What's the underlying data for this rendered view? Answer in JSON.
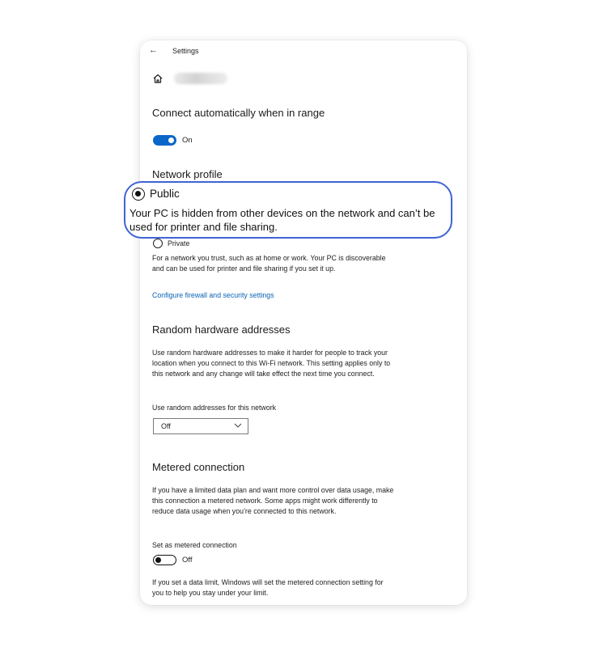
{
  "titlebar": {
    "back_glyph": "←",
    "title": "Settings"
  },
  "header": {
    "home_icon": "home-icon"
  },
  "connect": {
    "heading": "Connect automatically when in range",
    "toggle_label": "On"
  },
  "network_profile": {
    "heading": "Network profile",
    "public_label": "Public",
    "public_description": "Your PC is hidden from other devices on the network and can’t be used for printer and file sharing.",
    "private_label": "Private",
    "private_description": "For a network you trust, such as at home or work. Your PC is discoverable and can be used for printer and file sharing if you set it up.",
    "firewall_link": "Configure firewall and security settings"
  },
  "random_hw": {
    "heading": "Random hardware addresses",
    "description": "Use random hardware addresses to make it harder for people to track your location when you connect to this Wi-Fi network. This setting applies only to this network and any change will take effect the next time you connect.",
    "select_label": "Use random addresses for this network",
    "select_value": "Off"
  },
  "metered": {
    "heading": "Metered connection",
    "description": "If you have a limited data plan and want more control over data usage, make this connection a metered network. Some apps might work differently to reduce data usage when you’re connected to this network.",
    "toggle_heading": "Set as metered connection",
    "toggle_label": "Off",
    "footer": "If you set a data limit, Windows will set the metered connection setting for you to help you stay under your limit."
  },
  "colors": {
    "accent": "#0a66c8",
    "link": "#0a63b5",
    "highlight": "#3f63d6"
  }
}
